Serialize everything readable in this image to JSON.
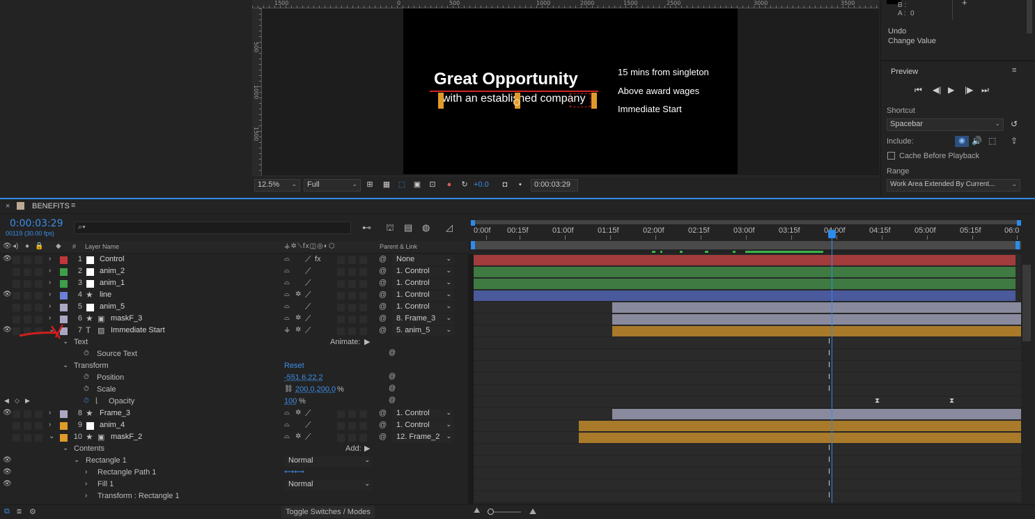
{
  "rulers": {
    "h": [
      "1500",
      "500",
      "0",
      "500",
      "1000",
      "1500",
      "2000",
      "2500",
      "3000",
      "3500"
    ],
    "v": [
      "500",
      "1000",
      "1500"
    ]
  },
  "comp": {
    "title": "Great Opportunity",
    "subtitle": "with an established company",
    "bullet1": "15 mins from singleton",
    "bullet2": "Above award wages",
    "bullet3": "Immediate Start"
  },
  "viewer": {
    "zoom": "12.5%",
    "resolution": "Full",
    "exposure": "+0.0",
    "timecode": "0:00:03:29"
  },
  "info": {
    "b": "B :",
    "a": "A :",
    "a_val": "0",
    "undo": "Undo",
    "change": "Change Value"
  },
  "preview": {
    "title": "Preview",
    "shortcut_label": "Shortcut",
    "shortcut": "Spacebar",
    "include": "Include:",
    "cache": "Cache Before Playback",
    "range_label": "Range",
    "range": "Work Area Extended By Current..."
  },
  "timeline": {
    "comp_name": "BENEFITS",
    "timecode": "0:00:03:29",
    "frames": "00119 (30.00 fps)",
    "col_hash": "#",
    "col_layer": "Layer Name",
    "col_parent": "Parent & Link",
    "toggle": "Toggle Switches / Modes",
    "ruler": [
      "0:00f",
      "00:15f",
      "01:00f",
      "01:15f",
      "02:00f",
      "02:15f",
      "03:00f",
      "03:15f",
      "04:00f",
      "04:15f",
      "05:00f",
      "05:15f",
      "06:0"
    ]
  },
  "layers": [
    {
      "num": "1",
      "name": "Control",
      "parent": "None",
      "color": "#c0383b"
    },
    {
      "num": "2",
      "name": "anim_2",
      "parent": "1. Control",
      "color": "#3e9e4a"
    },
    {
      "num": "3",
      "name": "anim_1",
      "parent": "1. Control",
      "color": "#3e9e4a"
    },
    {
      "num": "4",
      "name": "line",
      "parent": "1. Control",
      "color": "#6a7fd6"
    },
    {
      "num": "5",
      "name": "anim_5",
      "parent": "1. Control",
      "color": "#a9a8c4"
    },
    {
      "num": "6",
      "name": "maskF_3",
      "parent": "8. Frame_3",
      "color": "#a9a8c4"
    },
    {
      "num": "7",
      "name": "Immediate Start",
      "parent": "5. anim_5",
      "color": "#a9a8c4"
    },
    {
      "num": "8",
      "name": "Frame_3",
      "parent": "1. Control",
      "color": "#a9a8c4"
    },
    {
      "num": "9",
      "name": "anim_4",
      "parent": "1. Control",
      "color": "#e09a2a"
    },
    {
      "num": "10",
      "name": "maskF_2",
      "parent": "12. Frame_2",
      "color": "#e09a2a"
    }
  ],
  "props": {
    "text": "Text",
    "animate": "Animate:",
    "source_text": "Source Text",
    "transform": "Transform",
    "reset": "Reset",
    "position": "Position",
    "position_val": "-551.6,22.2",
    "scale": "Scale",
    "scale_val": "200.0,200.0",
    "pct": "%",
    "opacity": "Opacity",
    "opacity_val": "100",
    "contents": "Contents",
    "add": "Add:",
    "rect1": "Rectangle 1",
    "normal": "Normal",
    "rectpath": "Rectangle Path 1",
    "fill": "Fill 1",
    "normal2": "Normal",
    "transform_rect": "Transform : Rectangle 1"
  }
}
